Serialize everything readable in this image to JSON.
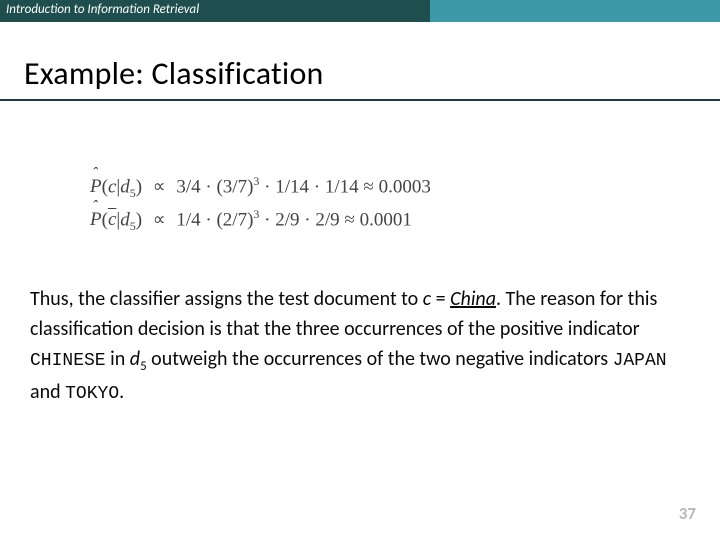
{
  "header": {
    "course": "Introduction to Information Retrieval"
  },
  "title": "Example: Classification",
  "math": {
    "row1": {
      "lhs_func": "P",
      "lhs_class": "c",
      "lhs_doc": "d",
      "lhs_docnum": "5",
      "prop": "∝",
      "t1": "3/4",
      "dot": "·",
      "t2_base": "(3/7)",
      "t2_exp": "3",
      "t3": "1/14",
      "t4": "1/14",
      "approx": "≈",
      "result": "0.0003"
    },
    "row2": {
      "lhs_func": "P",
      "lhs_class": "c",
      "lhs_doc": "d",
      "lhs_docnum": "5",
      "prop": "∝",
      "t1": "1/4",
      "dot": "·",
      "t2_base": "(2/7)",
      "t2_exp": "3",
      "t3": "2/9",
      "t4": "2/9",
      "approx": "≈",
      "result": "0.0001"
    }
  },
  "body": {
    "p1a": "Thus, the classifier assigns the test document to ",
    "c": "c",
    "eq": " = ",
    "china": "China",
    "p1b": ". The reason for this classification decision is that the three occurrences of the positive indicator ",
    "w_chinese": "CHINESE",
    "p1c": " in ",
    "d": "d",
    "d5": "5",
    "p1d": " outweigh the occurrences of the two negative indicators ",
    "w_japan": "JAPAN",
    "and": " and ",
    "w_tokyo": "TOKYO",
    "end": "."
  },
  "page": "37"
}
